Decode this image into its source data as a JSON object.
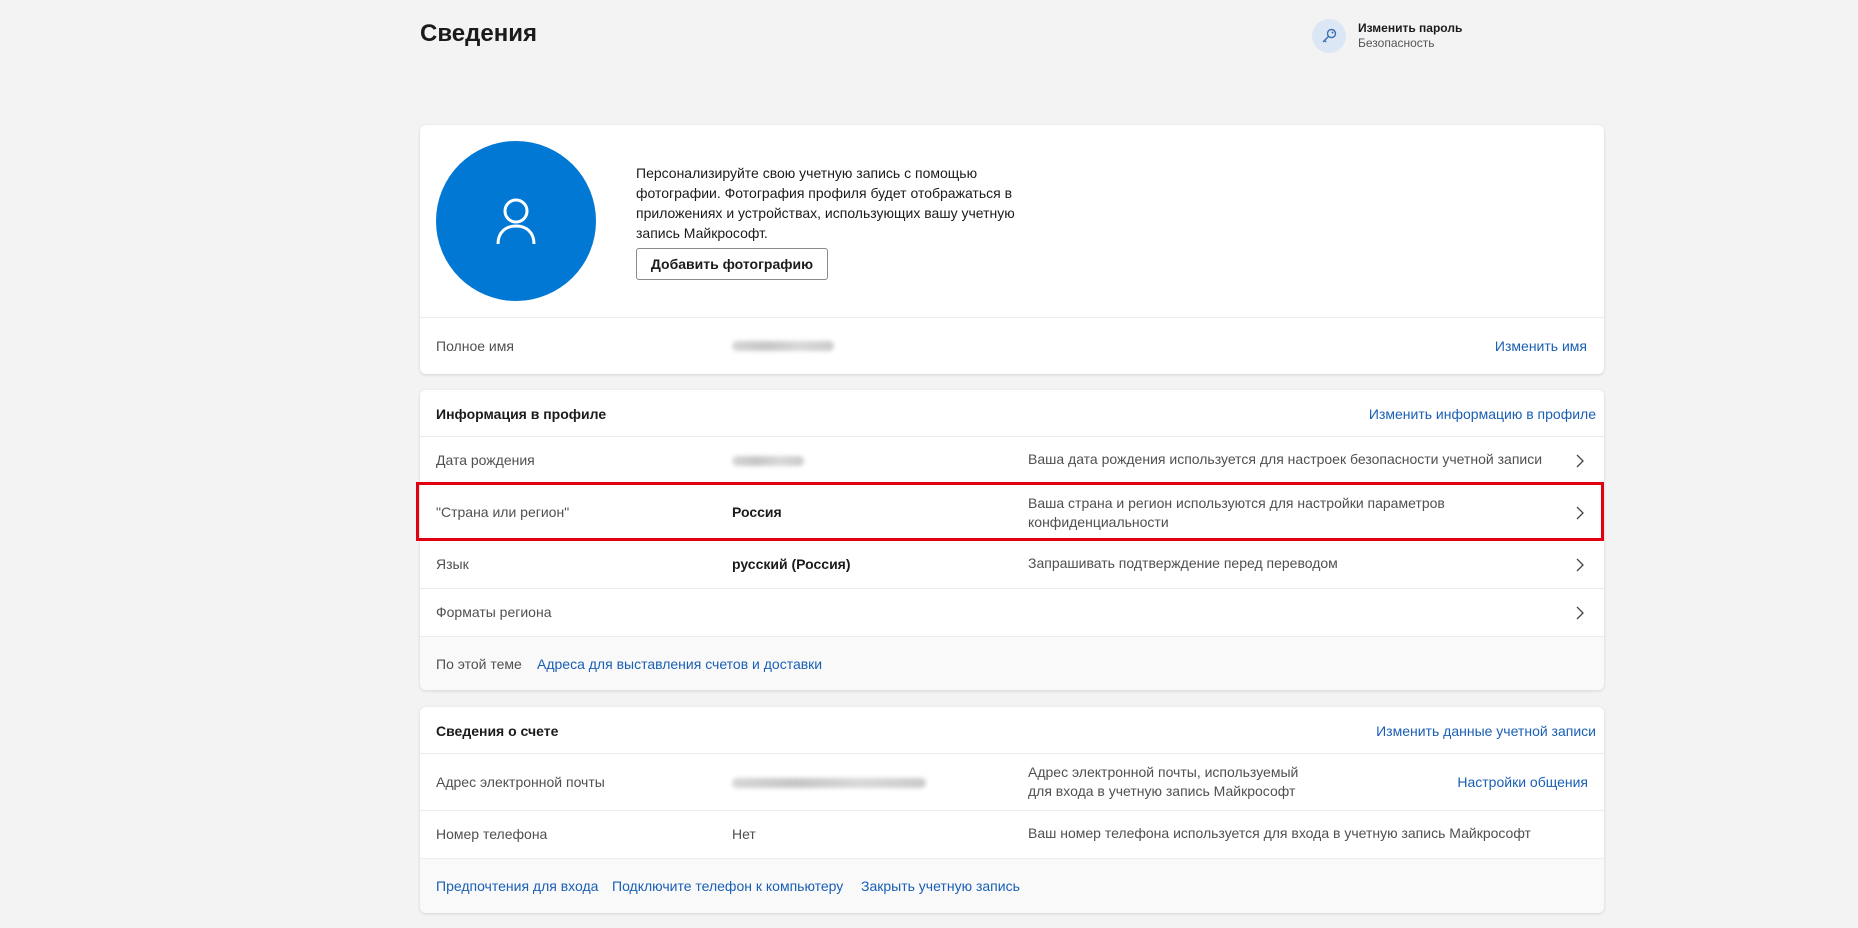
{
  "page": {
    "title": "Сведения"
  },
  "header_link": {
    "title": "Изменить пароль",
    "subtitle": "Безопасность",
    "icon": "key-icon"
  },
  "photo_card": {
    "text": "Персонализируйте свою учетную запись с помощью фотографии. Фотография профиля будет отображаться в приложениях и устройствах, использующих вашу учетную запись Майкрософт.",
    "button": "Добавить фотографию",
    "full_name_label": "Полное имя",
    "full_name_value": "",
    "change_name_link": "Изменить имя"
  },
  "profile_card": {
    "title": "Информация в профиле",
    "edit_link": "Изменить информацию в профиле",
    "rows": [
      {
        "label": "Дата рождения",
        "value": "",
        "desc": "Ваша дата рождения используется для настроек безопасности учетной записи"
      },
      {
        "label": "\"Страна или регион\"",
        "value": "Россия",
        "desc": "Ваша страна и регион используются для настройки параметров конфиденциальности"
      },
      {
        "label": "Язык",
        "value": "русский (Россия)",
        "desc": "Запрашивать подтверждение перед переводом"
      },
      {
        "label": "Форматы региона",
        "value": "",
        "desc": ""
      }
    ],
    "related_label": "По этой теме",
    "related_link": "Адреса для выставления счетов и доставки"
  },
  "account_card": {
    "title": "Сведения о счете",
    "edit_link": "Изменить данные учетной записи",
    "email_label": "Адрес электронной почты",
    "email_value": "",
    "email_desc": "Адрес электронной почты, используемый для входа в учетную запись Майкрософт",
    "email_link": "Настройки общения",
    "phone_label": "Номер телефона",
    "phone_value": "Нет",
    "phone_desc": "Ваш номер телефона используется для входа в учетную запись Майкрософт",
    "footer_links": [
      "Предпочтения для входа",
      "Подключите телефон к компьютеру",
      "Закрыть учетную запись"
    ]
  },
  "colors": {
    "accent": "#0078d4",
    "link": "#1a5fb4",
    "highlight": "#e0000f",
    "background": "#f3f3f3"
  }
}
